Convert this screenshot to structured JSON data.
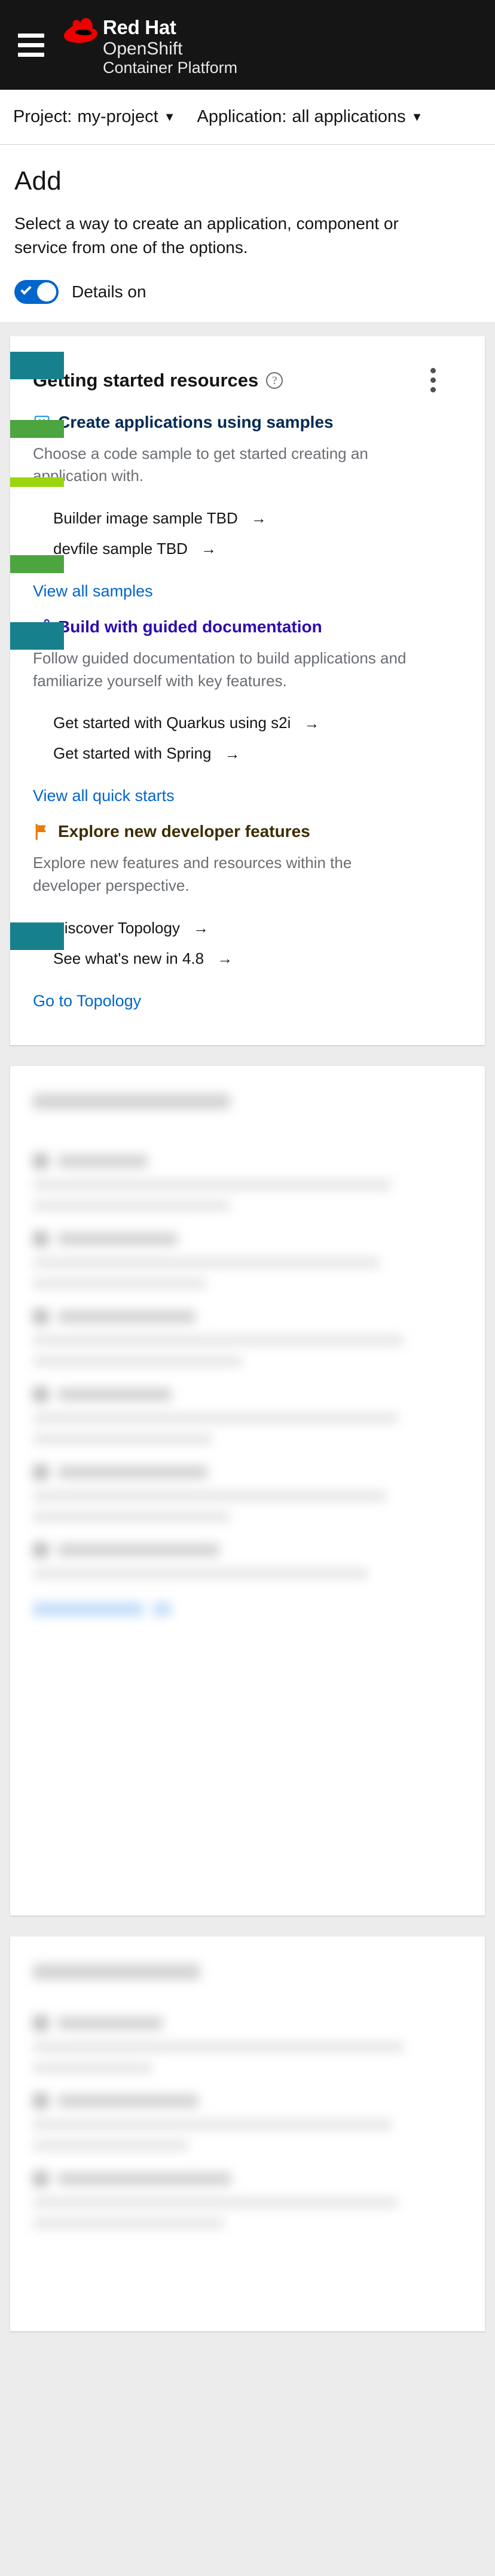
{
  "masthead": {
    "menu_icon": "hamburger-icon",
    "logo_icon": "red-hat-logo",
    "brand_line1": "Red Hat",
    "brand_line2": "OpenShift",
    "brand_line3": "Container Platform"
  },
  "projectbar": {
    "project": {
      "label": "Project:",
      "value": "my-project",
      "caret": "▼"
    },
    "application": {
      "label": "Application:",
      "value": "all applications",
      "caret": "▼"
    }
  },
  "page": {
    "title": "Add",
    "subtitle": "Select a way to create an application, component or service from one of the options.",
    "details_toggle_label": "Details on",
    "details_toggle_on": true
  },
  "getting_started": {
    "card_title": "Getting started resources",
    "help_icon": "question-circle-icon",
    "kebab_icon": "ellipsis-vertical-icon",
    "sections": [
      {
        "icon": "code-laptop-icon",
        "heading": "Create applications using samples",
        "description": "Choose a code sample to get started creating an application with.",
        "links": [
          {
            "label": "Builder image sample TBD",
            "arrow": "→"
          },
          {
            "label": "devfile sample TBD",
            "arrow": "→"
          }
        ],
        "cta": "View all samples"
      },
      {
        "icon": "route-path-icon",
        "heading": "Build with guided documentation",
        "description": "Follow guided documentation to build applications and familiarize yourself with key features.",
        "links": [
          {
            "label": "Get started with Quarkus using s2i",
            "arrow": "→"
          },
          {
            "label": "Get started with Spring",
            "arrow": "→"
          }
        ],
        "cta": "View all quick starts"
      },
      {
        "icon": "flag-icon",
        "heading": "Explore new developer features",
        "description": "Explore new features and resources within the developer perspective.",
        "links": [
          {
            "label": "Discover Topology",
            "arrow": "→"
          },
          {
            "label": "See what's new in 4.8",
            "arrow": "→"
          }
        ],
        "cta": "Go to Topology"
      }
    ]
  },
  "obscured_cards": [
    {
      "name": "developer-catalog-card"
    },
    {
      "name": "git-repository-card"
    }
  ],
  "colors": {
    "masthead_bg": "#151515",
    "page_bg": "#ececec",
    "card_bg": "#ffffff",
    "link_blue": "#0066cc",
    "toggle_on": "#0066cc",
    "samples_title": "#002952",
    "docs_title": "#2e0bad",
    "features_title": "#3d2c00",
    "marker_teal": "#17808d",
    "marker_green": "#4ca53f",
    "marker_lime": "#9bd510"
  }
}
